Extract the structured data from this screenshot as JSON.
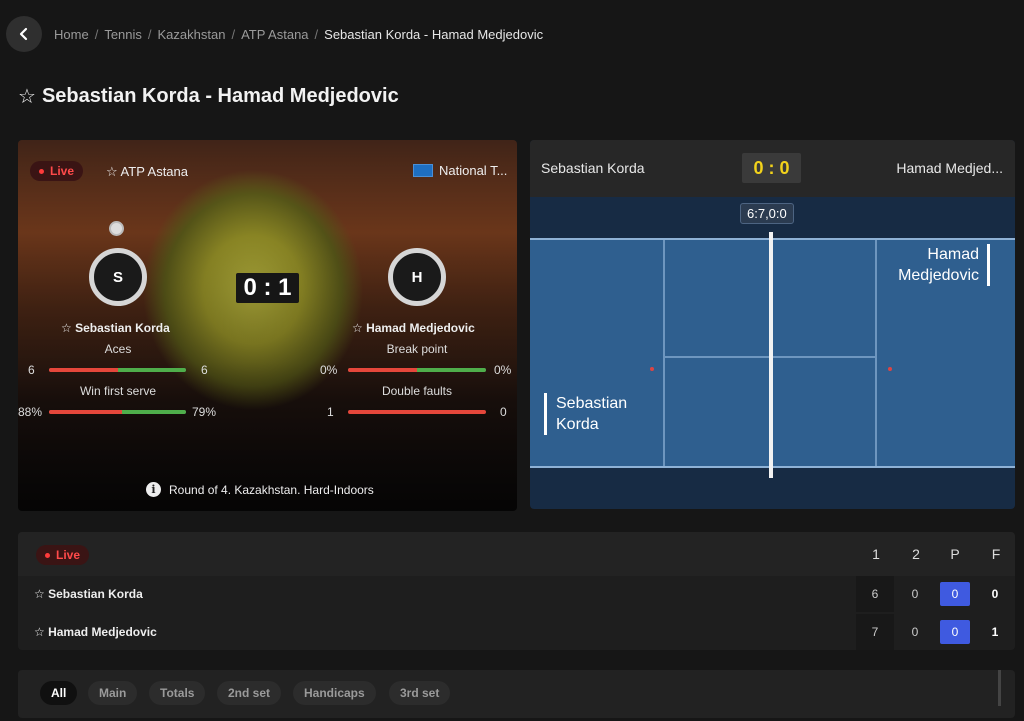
{
  "breadcrumb": {
    "items": [
      "Home",
      "Tennis",
      "Kazakhstan",
      "ATP Astana"
    ],
    "separator": "/",
    "current": "Sebastian Korda - Hamad Medjedovic"
  },
  "page": {
    "star": "☆",
    "title": "Sebastian Korda - Hamad Medjedovic"
  },
  "match": {
    "live_label": "Live",
    "tournament": "☆ ATP Astana",
    "national": "National T...",
    "score": "0 : 1",
    "player1": {
      "initial": "S",
      "name": "☆ Sebastian Korda"
    },
    "player2": {
      "initial": "H",
      "name": "☆ Hamad Medjedovic"
    },
    "stats_left": [
      {
        "label": "Aces",
        "left": "6",
        "right": "6",
        "left_frac": 0.5
      },
      {
        "label": "Win first serve",
        "left": "88%",
        "right": "79%",
        "left_frac": 0.53
      }
    ],
    "stats_right": [
      {
        "label": "Break point",
        "left": "0%",
        "right": "0%",
        "left_frac": 0.5
      },
      {
        "label": "Double faults",
        "left": "1",
        "right": "0",
        "left_frac": 1.0
      }
    ],
    "round_info": "Round of 4. Kazakhstan. Hard-Indoors"
  },
  "court": {
    "player1": "Sebastian Korda",
    "player2": "Hamad Medjed...",
    "score": "0 : 0",
    "game_tag": "6:7,0:0",
    "name_top_line1": "Hamad",
    "name_top_line2": "Medjedovic",
    "name_bottom_line1": "Sebastian",
    "name_bottom_line2": "Korda"
  },
  "scoreboard": {
    "live_label": "Live",
    "columns": [
      "1",
      "2",
      "P",
      "F"
    ],
    "rows": [
      {
        "name": "☆ Sebastian Korda",
        "set1": "6",
        "set2": "0",
        "points": "0",
        "final": "0"
      },
      {
        "name": "☆ Hamad Medjedovic",
        "set1": "7",
        "set2": "0",
        "points": "0",
        "final": "1"
      }
    ]
  },
  "tabs": [
    "All",
    "Main",
    "Totals",
    "2nd set",
    "Handicaps",
    "3rd set"
  ],
  "colors": {
    "live_red": "#ff4a4a",
    "court_blue": "#2f5f8f",
    "score_yellow": "#f2d21b",
    "point_blue": "#3f5ae0",
    "bar_red": "#e5473b",
    "bar_green": "#4fae4b"
  },
  "icons": {
    "back": "chevron-left-icon",
    "info": "info-icon",
    "ball": "tennis-ball-icon",
    "flag": "flag-icon"
  }
}
